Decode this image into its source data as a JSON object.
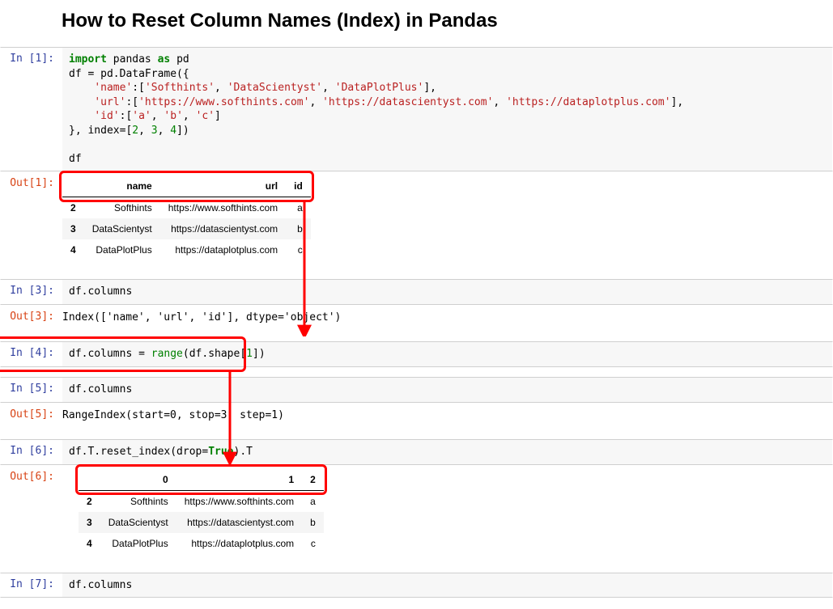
{
  "title": "How to Reset Column Names (Index) in Pandas",
  "cells": {
    "in1_prompt": "In [1]:",
    "out1_prompt": "Out[1]:",
    "in3_prompt": "In [3]:",
    "out3_prompt": "Out[3]:",
    "in4_prompt": "In [4]:",
    "in5_prompt": "In [5]:",
    "out5_prompt": "Out[5]:",
    "in6_prompt": "In [6]:",
    "out6_prompt": "Out[6]:",
    "in7_prompt": "In [7]:",
    "code1": {
      "l1a": "import",
      "l1b": " pandas ",
      "l1c": "as",
      "l1d": " pd",
      "l2": "df = pd.DataFrame({",
      "l3a": "    ",
      "l3b": "'name'",
      "l3c": ":[",
      "l3d": "'Softhints'",
      "l3e": ", ",
      "l3f": "'DataScientyst'",
      "l3g": ", ",
      "l3h": "'DataPlotPlus'",
      "l3i": "],",
      "l4a": "    ",
      "l4b": "'url'",
      "l4c": ":[",
      "l4d": "'https://www.softhints.com'",
      "l4e": ", ",
      "l4f": "'https://datascientyst.com'",
      "l4g": ", ",
      "l4h": "'https://dataplotplus.com'",
      "l4i": "],",
      "l5a": "    ",
      "l5b": "'id'",
      "l5c": ":[",
      "l5d": "'a'",
      "l5e": ", ",
      "l5f": "'b'",
      "l5g": ", ",
      "l5h": "'c'",
      "l5i": "]",
      "l6a": "}, index=[",
      "l6b": "2",
      "l6c": ", ",
      "l6d": "3",
      "l6e": ", ",
      "l6f": "4",
      "l6g": "])",
      "l7": "",
      "l8": "df"
    },
    "table1": {
      "headers": [
        "",
        "name",
        "url",
        "id"
      ],
      "rows": [
        [
          "2",
          "Softhints",
          "https://www.softhints.com",
          "a"
        ],
        [
          "3",
          "DataScientyst",
          "https://datascientyst.com",
          "b"
        ],
        [
          "4",
          "DataPlotPlus",
          "https://dataplotplus.com",
          "c"
        ]
      ]
    },
    "code3": "df.columns",
    "out3_text": "Index(['name', 'url', 'id'], dtype='object')",
    "code4": {
      "a": "df.columns = ",
      "b": "range",
      "c": "(df.shape[",
      "d": "1",
      "e": "])"
    },
    "code5": "df.columns",
    "out5_text": "RangeIndex(start=0, stop=3, step=1)",
    "code6": {
      "a": "df.T.reset_index(drop=",
      "b": "True",
      "c": ").T"
    },
    "table6": {
      "headers": [
        "",
        "0",
        "1",
        "2"
      ],
      "rows": [
        [
          "2",
          "Softhints",
          "https://www.softhints.com",
          "a"
        ],
        [
          "3",
          "DataScientyst",
          "https://datascientyst.com",
          "b"
        ],
        [
          "4",
          "DataPlotPlus",
          "https://dataplotplus.com",
          "c"
        ]
      ]
    },
    "code7": "df.columns"
  },
  "annotations": {
    "highlight_color": "#ff0000"
  }
}
